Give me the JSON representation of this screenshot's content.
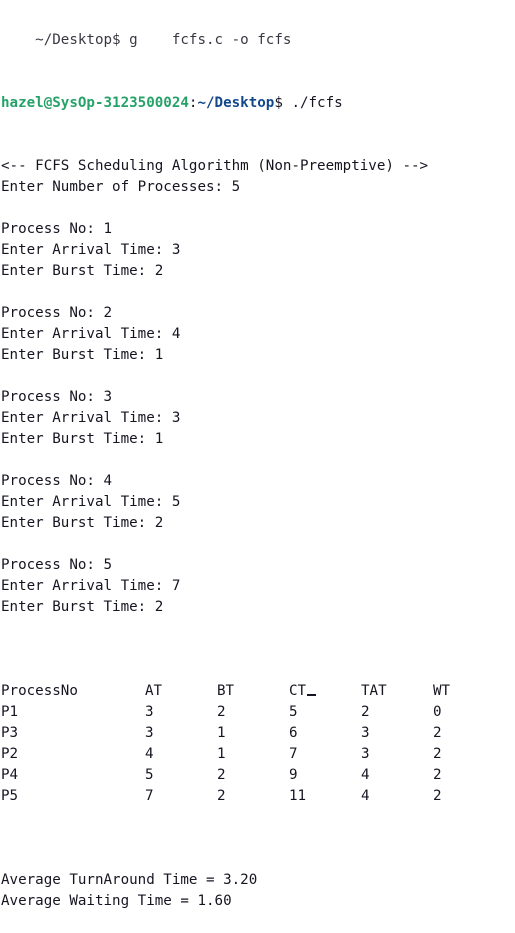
{
  "terminal": {
    "cut_line": "    ~/Desktop$ g    fcfs.c -o fcfs",
    "prompt": {
      "user_host": "hazel@SysOp-3123500024",
      "sep": ":",
      "path": "~/Desktop",
      "symbol": "$ ",
      "command": "./fcfs"
    },
    "lines": [
      "<-- FCFS Scheduling Algorithm (Non-Preemptive) -->",
      "Enter Number of Processes: 5",
      "",
      "Process No: 1",
      "Enter Arrival Time: 3",
      "Enter Burst Time: 2",
      "",
      "Process No: 2",
      "Enter Arrival Time: 4",
      "Enter Burst Time: 1",
      "",
      "Process No: 3",
      "Enter Arrival Time: 3",
      "Enter Burst Time: 1",
      "",
      "Process No: 4",
      "Enter Arrival Time: 5",
      "Enter Burst Time: 2",
      "",
      "Process No: 5",
      "Enter Arrival Time: 7",
      "Enter Burst Time: 2",
      ""
    ],
    "table": {
      "headers": [
        "ProcessNo",
        "AT",
        "BT",
        "CT",
        "TAT",
        "WT"
      ],
      "rows": [
        [
          "P1",
          "3",
          "2",
          "5",
          "2",
          "0"
        ],
        [
          "P3",
          "3",
          "1",
          "6",
          "3",
          "2"
        ],
        [
          "P2",
          "4",
          "1",
          "7",
          "3",
          "2"
        ],
        [
          "P4",
          "5",
          "2",
          "9",
          "4",
          "2"
        ],
        [
          "P5",
          "7",
          "2",
          "11",
          "4",
          "2"
        ]
      ]
    },
    "footer": [
      "",
      "Average TurnAround Time = 3.20",
      "Average Waiting Time = 1.60"
    ]
  },
  "colors": {
    "prompt_user": "#26a269",
    "prompt_path": "#12488b",
    "text": "#171421",
    "background": "#ffffff"
  }
}
